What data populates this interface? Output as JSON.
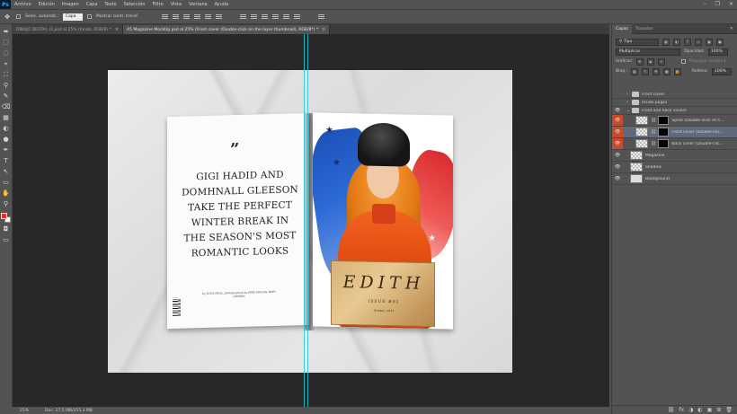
{
  "app": {
    "logo": "Ps"
  },
  "menu": [
    "Archivo",
    "Edición",
    "Imagen",
    "Capa",
    "Texto",
    "Selección",
    "Filtro",
    "Vista",
    "Ventana",
    "Ayuda"
  ],
  "window_controls": [
    "–",
    "❐",
    "✕"
  ],
  "options": {
    "auto_select_label": "Selec. automát.:",
    "auto_select_value": "Capa",
    "transform_label": "Mostrar contr. transf."
  },
  "tabs": [
    {
      "label": "DIBUJO DIGITAL (1.psd al 25% (fondo, RGB/8) *",
      "close": "×"
    },
    {
      "label": "A5 Magazine MockUp.psd al 25% (Front cover (Double-click on the layer thumbnail), RGB/8*) *",
      "close": "×"
    }
  ],
  "tools": [
    "⬌",
    "⬚",
    "◌",
    "⌖",
    "⛶",
    "⚲",
    "✎",
    "⌫",
    "▦",
    "◐",
    "●",
    "✒",
    "T",
    "↖",
    "▭",
    "✋",
    "⚲"
  ],
  "canvas": {
    "back_cover": {
      "quote_mark": "”",
      "headline": "GIGI HADID AND DOMHNALL GLEESON TAKE THE PERFECT WINTER BREAK IN THE SEASON'S MOST ROMANTIC LOOKS",
      "credit": "by SOFIA MESS, photographed by MIKE HAVLAN, MARY LONDON"
    },
    "front_cover": {
      "masthead": "EDITH",
      "issue": "ISSUE #02",
      "date": "October / 2017"
    }
  },
  "status": {
    "zoom": "25%",
    "doc": "Doc: 27,5 MB/455,3 MB"
  },
  "panel": {
    "tabs": [
      "Capas",
      "Trazados"
    ],
    "close": "✕",
    "filter_label": "Tipo",
    "blend_mode": "Multiplicar",
    "opacity_label": "Opacidad:",
    "opacity_value": "100%",
    "unify_label": "Unificar:",
    "propagate_label": "Propagar cuadro 1",
    "lock_label": "Bloq.:",
    "fill_label": "Relleno:",
    "fill_value": "100%",
    "layers": [
      {
        "name": "Front cover",
        "type": "folder",
        "visible": false,
        "highlight": false,
        "indent": 1
      },
      {
        "name": "Inside pages",
        "type": "folder",
        "visible": false,
        "highlight": false,
        "indent": 1
      },
      {
        "name": "Front and back covers",
        "type": "folder",
        "visible": true,
        "highlight": false,
        "indent": 1,
        "open": true
      },
      {
        "name": "Spine (Double-click on t...",
        "type": "smart",
        "visible": true,
        "highlight": true,
        "indent": 2
      },
      {
        "name": "Front cover (Double-clic...",
        "type": "smart",
        "visible": true,
        "highlight": true,
        "indent": 2,
        "selected": true
      },
      {
        "name": "Back cover (Double-clic...",
        "type": "smart",
        "visible": true,
        "highlight": true,
        "indent": 2
      },
      {
        "name": "Magazine",
        "type": "layer",
        "visible": true,
        "highlight": false,
        "indent": 1
      },
      {
        "name": "Shadow",
        "type": "layer",
        "visible": true,
        "highlight": false,
        "indent": 1
      },
      {
        "name": "Background",
        "type": "layer",
        "visible": true,
        "highlight": false,
        "indent": 1
      }
    ],
    "footer_icons": [
      "⛓",
      "fx",
      "◑",
      "◐",
      "▣",
      "⊞",
      "🗑"
    ]
  }
}
